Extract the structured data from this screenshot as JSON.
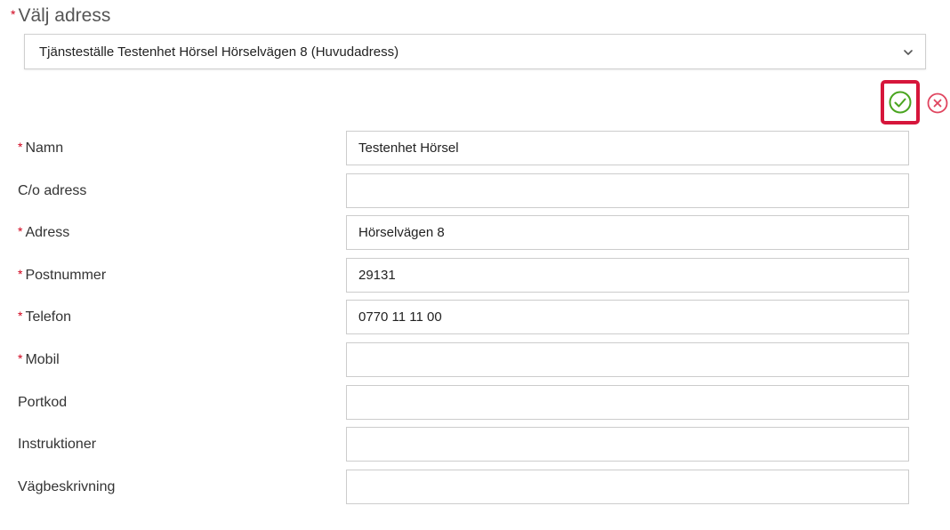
{
  "address_select": {
    "label": "Välj adress",
    "required_mark": "*",
    "selected_value": "Tjänsteställe Testenhet Hörsel Hörselvägen 8 (Huvudadress)"
  },
  "actions": {
    "confirm_icon": "check-circle-icon",
    "cancel_icon": "x-circle-icon",
    "confirm_color": "#4aa520",
    "cancel_color": "#e0455f",
    "highlight_color": "#d6163b"
  },
  "form": {
    "fields": [
      {
        "label": "Namn",
        "required": true,
        "value": "Testenhet Hörsel"
      },
      {
        "label": "C/o adress",
        "required": false,
        "value": ""
      },
      {
        "label": "Adress",
        "required": true,
        "value": "Hörselvägen 8"
      },
      {
        "label": "Postnummer",
        "required": true,
        "value": "29131"
      },
      {
        "label": "Telefon",
        "required": true,
        "value": "0770 11 11 00"
      },
      {
        "label": "Mobil",
        "required": true,
        "value": ""
      },
      {
        "label": "Portkod",
        "required": false,
        "value": ""
      },
      {
        "label": "Instruktioner",
        "required": false,
        "value": ""
      },
      {
        "label": "Vägbeskrivning",
        "required": false,
        "value": ""
      }
    ]
  }
}
